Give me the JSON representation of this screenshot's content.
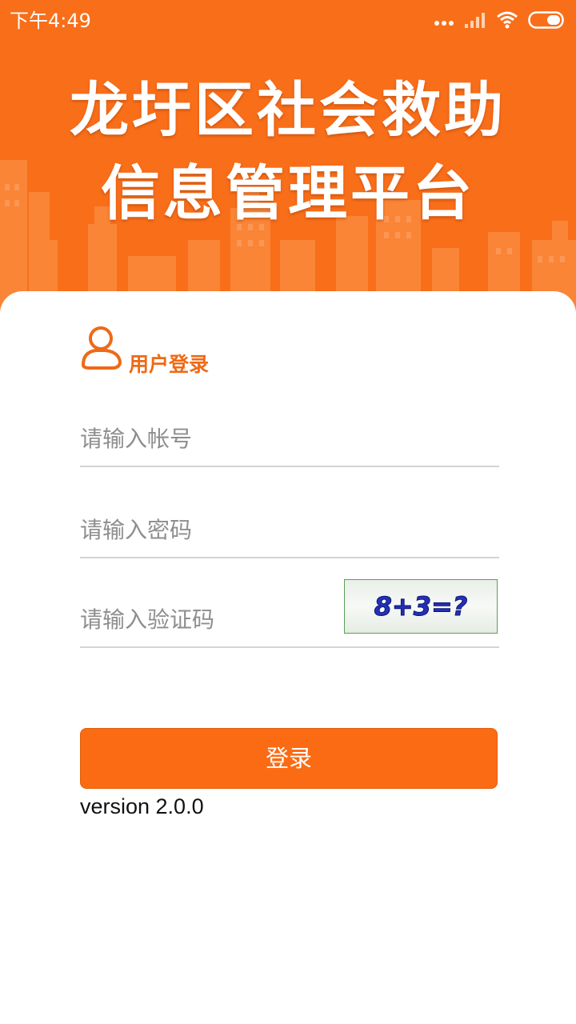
{
  "status_bar": {
    "time": "下午4:49",
    "icons": [
      "more-dots-icon",
      "cellular-signal-icon",
      "wifi-icon",
      "battery-icon"
    ]
  },
  "header": {
    "title_line1": "龙圩区社会救助",
    "title_line2": "信息管理平台",
    "background_color": "#f96e19"
  },
  "login": {
    "heading": "用户登录",
    "heading_icon": "user-icon",
    "account_placeholder": "请输入帐号",
    "password_placeholder": "请输入密码",
    "captcha_placeholder": "请输入验证码",
    "captcha_text": "8+3=?",
    "submit_label": "登录",
    "accent_color": "#fb6b13"
  },
  "footer": {
    "version": "version 2.0.0"
  }
}
